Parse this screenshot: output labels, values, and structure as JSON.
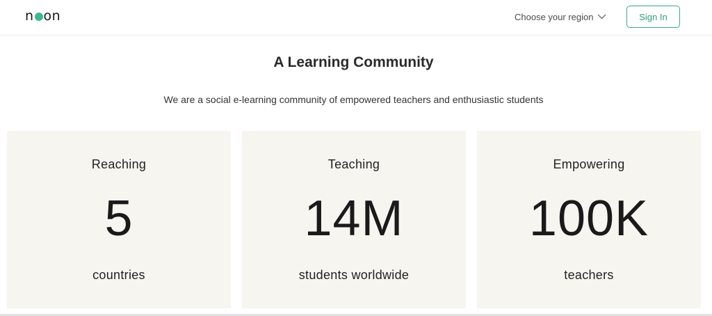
{
  "header": {
    "logo": {
      "left": "n",
      "right": "on",
      "dot_color": "#3db88f"
    },
    "region_label": "Choose your region",
    "region_icon": "chevron-down-icon",
    "signin_label": "Sign In",
    "accent_color": "#3aa987"
  },
  "main": {
    "title": "A Learning Community",
    "subtitle": "We are a social e-learning community of empowered teachers and enthusiastic students",
    "stats": [
      {
        "label": "Reaching",
        "value": "5",
        "caption": "countries"
      },
      {
        "label": "Teaching",
        "value": "14M",
        "caption": "students worldwide"
      },
      {
        "label": "Empowering",
        "value": "100K",
        "caption": "teachers"
      }
    ],
    "card_background": "#f7f5f0"
  }
}
